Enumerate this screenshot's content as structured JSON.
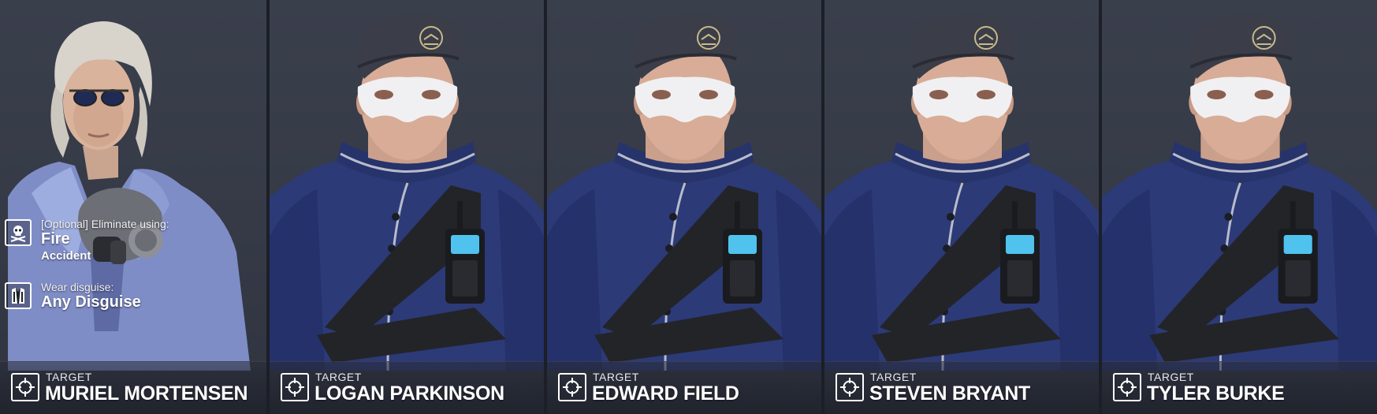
{
  "objectives": {
    "eliminate": {
      "label": "[Optional] Eliminate using:",
      "method": "Fire",
      "type": "Accident",
      "icon": "skull-crossbones-icon"
    },
    "disguise": {
      "label": "Wear disguise:",
      "value": "Any Disguise",
      "icon": "suit-disguise-icon"
    }
  },
  "targets": [
    {
      "label": "TARGET",
      "name": "MURIEL MORTENSEN",
      "icon": "crosshair-icon"
    },
    {
      "label": "TARGET",
      "name": "LOGAN PARKINSON",
      "icon": "crosshair-icon"
    },
    {
      "label": "TARGET",
      "name": "EDWARD FIELD",
      "icon": "crosshair-icon"
    },
    {
      "label": "TARGET",
      "name": "STEVEN BRYANT",
      "icon": "crosshair-icon"
    },
    {
      "label": "TARGET",
      "name": "TYLER BURKE",
      "icon": "crosshair-icon"
    }
  ],
  "colors": {
    "background": "#353a46",
    "uniform": "#2c3a78",
    "beret": "#3b3d48",
    "text": "#ffffff"
  }
}
